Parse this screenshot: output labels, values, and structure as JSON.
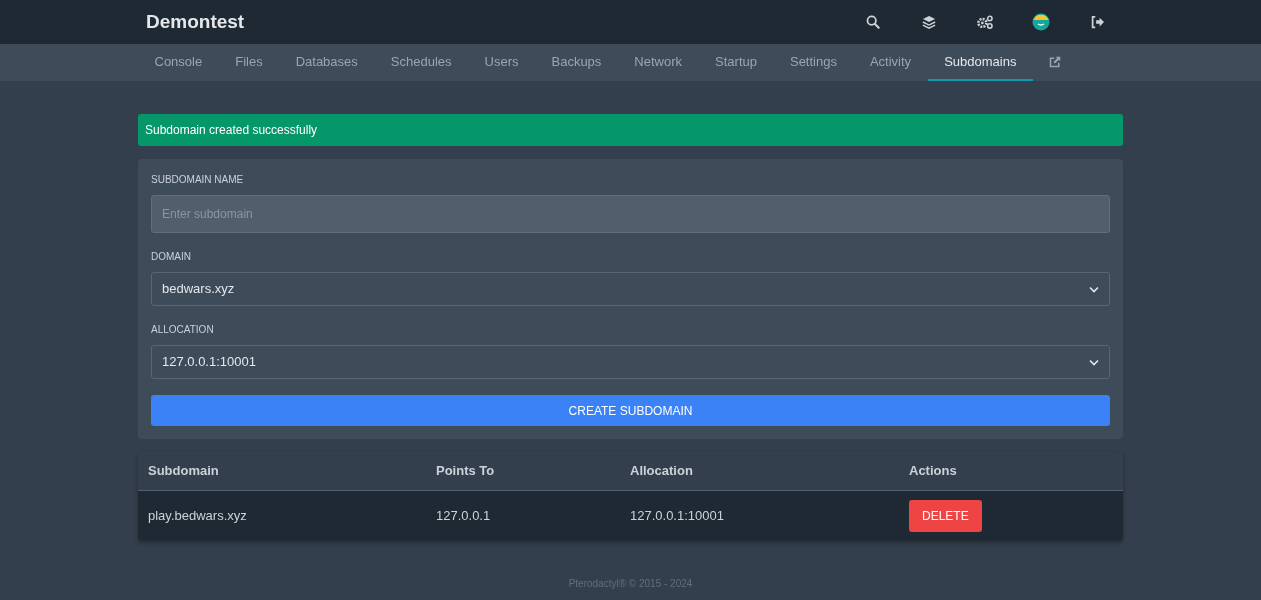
{
  "brand": "Demontest",
  "tabs": [
    {
      "label": "Console",
      "selected": false
    },
    {
      "label": "Files",
      "selected": false
    },
    {
      "label": "Databases",
      "selected": false
    },
    {
      "label": "Schedules",
      "selected": false
    },
    {
      "label": "Users",
      "selected": false
    },
    {
      "label": "Backups",
      "selected": false
    },
    {
      "label": "Network",
      "selected": false
    },
    {
      "label": "Startup",
      "selected": false
    },
    {
      "label": "Settings",
      "selected": false
    },
    {
      "label": "Activity",
      "selected": false
    },
    {
      "label": "Subdomains",
      "selected": true
    }
  ],
  "alert": {
    "text": "Subdomain created successfully"
  },
  "form": {
    "fields": [
      {
        "kind": "input",
        "label": "SUBDOMAIN NAME",
        "placeholder": "Enter subdomain"
      },
      {
        "kind": "select",
        "label": "DOMAIN",
        "value": "bedwars.xyz"
      },
      {
        "kind": "select",
        "label": "ALLOCATION",
        "value": "127.0.0.1:10001"
      }
    ],
    "submit": "CREATE SUBDOMAIN"
  },
  "table": {
    "columns": [
      "Subdomain",
      "Points To",
      "Allocation",
      "Actions"
    ],
    "rows": [
      {
        "cells": [
          "play.bedwars.xyz",
          "127.0.0.1",
          "127.0.0.1:10001"
        ],
        "action": "DELETE"
      }
    ]
  },
  "footer": "Pterodactyl® © 2015 - 2024"
}
